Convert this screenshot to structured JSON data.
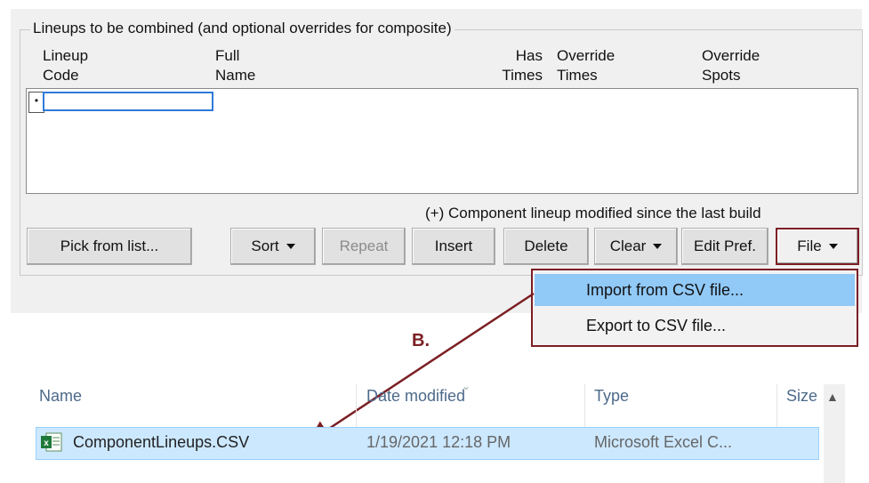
{
  "group": {
    "legend": "Lineups to be combined (and optional overrides for composite)",
    "columns": [
      {
        "line1": "Lineup",
        "line2": "Code"
      },
      {
        "line1": "Full",
        "line2": "Name"
      },
      {
        "line1": "Has",
        "line2": "Times"
      },
      {
        "line1": "Override",
        "line2": "Times"
      },
      {
        "line1": "Override",
        "line2": "Spots"
      }
    ],
    "row_marker": "•",
    "note": "(+)  Component lineup modified since the last build"
  },
  "buttons": {
    "pick": "Pick from list...",
    "sort": "Sort",
    "repeat": "Repeat",
    "insert": "Insert",
    "delete": "Delete",
    "clear": "Clear",
    "edit_pref": "Edit Pref.",
    "file": "File"
  },
  "file_menu": {
    "items": [
      "Import from CSV file...",
      "Export to CSV file..."
    ],
    "highlighted_index": 0
  },
  "annotation": {
    "label": "B.",
    "color": "#7b1f24"
  },
  "explorer": {
    "columns": [
      "Name",
      "Date modified",
      "Type",
      "Size"
    ],
    "rows": [
      {
        "name": "ComponentLineups.CSV",
        "date": "1/19/2021 12:18 PM",
        "type": "Microsoft Excel C..."
      }
    ]
  }
}
